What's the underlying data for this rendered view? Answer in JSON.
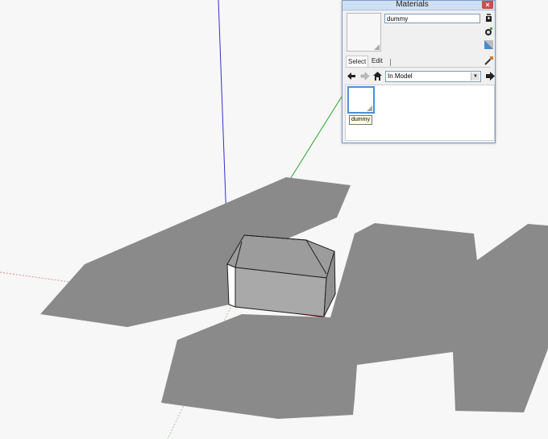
{
  "window": {
    "title": "Materials",
    "close_icon": "close-icon"
  },
  "material": {
    "name_value": "dummy"
  },
  "tabs": [
    {
      "label": "Select"
    },
    {
      "label": "Edit"
    }
  ],
  "library": {
    "selected": "In Model"
  },
  "swatches": [
    {
      "label": "dummy",
      "color": "#ffffff"
    }
  ],
  "scene": {
    "colors": {
      "background": "#f7f7f7",
      "ground_shadow": "#8a8a8a",
      "house_wall": "#a9a9a9",
      "house_roof": "#9c9c9c",
      "axis_red": "#d02020",
      "axis_green": "#2aa52a",
      "axis_blue": "#2020d0"
    }
  }
}
